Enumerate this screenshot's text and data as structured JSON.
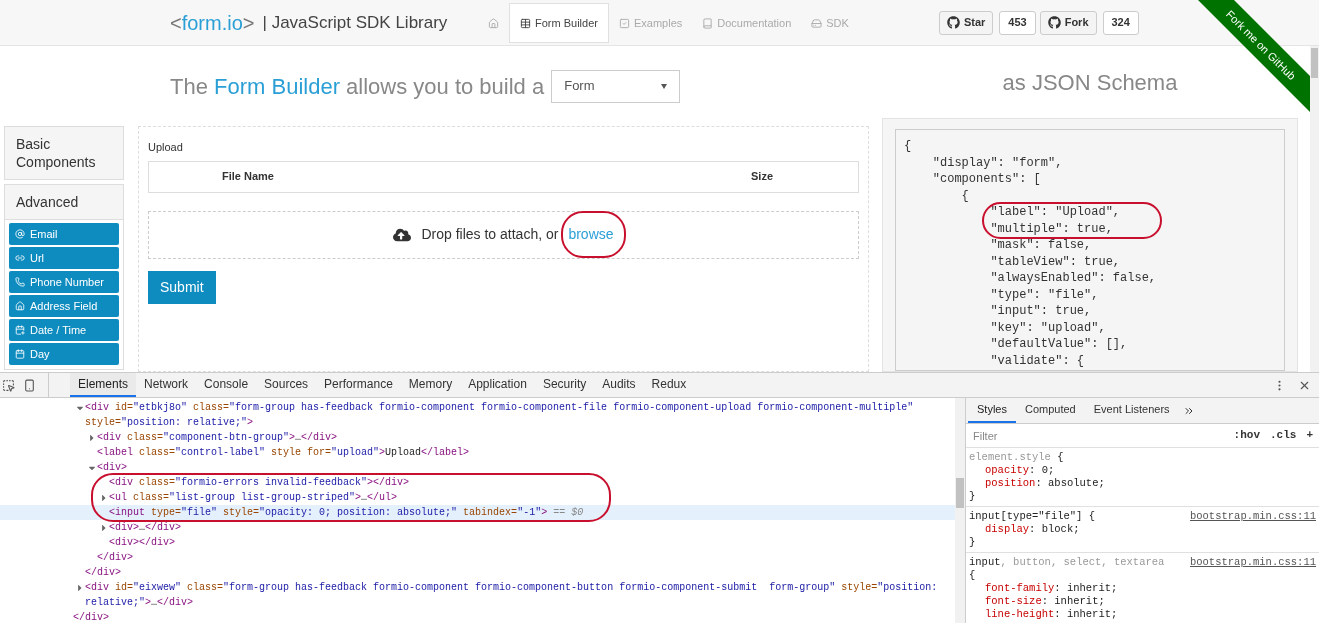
{
  "header": {
    "logo": {
      "open": "<",
      "name": "form.io",
      "close": ">"
    },
    "subtitle": "| JavaScript SDK Library",
    "nav": [
      {
        "selected": false
      },
      {
        "label": "Form Builder",
        "selected": true
      },
      {
        "label": "Examples",
        "selected": false
      },
      {
        "label": "Documentation",
        "selected": false
      },
      {
        "label": "SDK",
        "selected": false
      }
    ],
    "github": [
      {
        "label": "Star",
        "count": "453"
      },
      {
        "label": "Fork",
        "count": "324"
      }
    ],
    "ribbon": "Fork me on GitHub"
  },
  "builder": {
    "heading": [
      {
        "text": "The ",
        "accent": false
      },
      {
        "text": "Form Builder",
        "accent": true
      },
      {
        "text": " allows you to build a",
        "accent": false
      }
    ],
    "display_select": "Form",
    "groups": [
      "Basic Components",
      "Advanced"
    ],
    "components": [
      "Email",
      "Url",
      "Phone Number",
      "Address Field",
      "Date / Time",
      "Day"
    ],
    "form": {
      "upload_label": "Upload",
      "columns": [
        "File Name",
        "Size"
      ],
      "drop_text": "Drop files to attach, or",
      "browse_link": "browse",
      "browse_circled": true,
      "submit": "Submit"
    }
  },
  "schema": {
    "title": "as JSON Schema",
    "lines": [
      {
        "text": "{",
        "circled": false
      },
      {
        "text": "    \"display\": \"form\",",
        "circled": false
      },
      {
        "text": "    \"components\": [",
        "circled": false
      },
      {
        "text": "        {",
        "circled": false
      },
      {
        "text": "            \"label\": \"Upload\",",
        "circled": true
      },
      {
        "text": "            \"multiple\": true,",
        "circled": true
      },
      {
        "text": "            \"mask\": false,",
        "circled": false
      },
      {
        "text": "            \"tableView\": true,",
        "circled": false
      },
      {
        "text": "            \"alwaysEnabled\": false,",
        "circled": false
      },
      {
        "text": "            \"type\": \"file\",",
        "circled": false
      },
      {
        "text": "            \"input\": true,",
        "circled": false
      },
      {
        "text": "            \"key\": \"upload\",",
        "circled": false
      },
      {
        "text": "            \"defaultValue\": [],",
        "circled": false
      },
      {
        "text": "            \"validate\": {",
        "circled": false
      }
    ]
  },
  "devtools": {
    "tabs": [
      {
        "label": "Elements",
        "selected": true
      },
      {
        "label": "Network",
        "selected": false
      },
      {
        "label": "Console",
        "selected": false
      },
      {
        "label": "Sources",
        "selected": false
      },
      {
        "label": "Performance",
        "selected": false
      },
      {
        "label": "Memory",
        "selected": false
      },
      {
        "label": "Application",
        "selected": false
      },
      {
        "label": "Security",
        "selected": false
      },
      {
        "label": "Audits",
        "selected": false
      },
      {
        "label": "Redux",
        "selected": false
      }
    ],
    "dom": {
      "nodes": [
        {
          "expanded": true,
          "selected": false,
          "circled": false,
          "segs": [
            {
              "kind": "tag",
              "text": "<div"
            },
            {
              "kind": "attr",
              "text": " id="
            },
            {
              "kind": "val",
              "text": "\"etbkj8o\""
            },
            {
              "kind": "attr",
              "text": " class="
            },
            {
              "kind": "val",
              "text": "\"form-group has-feedback formio-component formio-component-file formio-component-upload formio-component-multiple\""
            },
            {
              "kind": "attr",
              "text": " style="
            },
            {
              "kind": "val",
              "text": "\"position: relative;\""
            },
            {
              "kind": "tag",
              "text": ">"
            }
          ],
          "children": [
            {
              "expanded": false,
              "selected": false,
              "circled": false,
              "segs": [
                {
                  "kind": "tag",
                  "text": "<div"
                },
                {
                  "kind": "attr",
                  "text": " class="
                },
                {
                  "kind": "val",
                  "text": "\"component-btn-group\""
                },
                {
                  "kind": "tag",
                  "text": ">"
                },
                {
                  "kind": "text",
                  "text": "…"
                },
                {
                  "kind": "tag",
                  "text": "</div>"
                }
              ]
            },
            {
              "selected": false,
              "circled": false,
              "segs": [
                {
                  "kind": "tag",
                  "text": "<label"
                },
                {
                  "kind": "attr",
                  "text": " class="
                },
                {
                  "kind": "val",
                  "text": "\"control-label\""
                },
                {
                  "kind": "attr",
                  "text": " style for="
                },
                {
                  "kind": "val",
                  "text": "\"upload\""
                },
                {
                  "kind": "tag",
                  "text": ">"
                },
                {
                  "kind": "text",
                  "text": "Upload"
                },
                {
                  "kind": "tag",
                  "text": "</label>"
                }
              ]
            },
            {
              "expanded": true,
              "selected": false,
              "circled": false,
              "segs": [
                {
                  "kind": "tag",
                  "text": "<div>"
                }
              ],
              "children": [
                {
                  "selected": false,
                  "circled": true,
                  "segs": [
                    {
                      "kind": "tag",
                      "text": "<div"
                    },
                    {
                      "kind": "attr",
                      "text": " class="
                    },
                    {
                      "kind": "val",
                      "text": "\"formio-errors invalid-feedback\""
                    },
                    {
                      "kind": "tag",
                      "text": ">"
                    },
                    {
                      "kind": "tag",
                      "text": "</div>"
                    }
                  ]
                },
                {
                  "expanded": false,
                  "selected": false,
                  "circled": true,
                  "segs": [
                    {
                      "kind": "tag",
                      "text": "<ul"
                    },
                    {
                      "kind": "attr",
                      "text": " class="
                    },
                    {
                      "kind": "val",
                      "text": "\"list-group list-group-striped\""
                    },
                    {
                      "kind": "tag",
                      "text": ">"
                    },
                    {
                      "kind": "text",
                      "text": "…"
                    },
                    {
                      "kind": "tag",
                      "text": "</ul>"
                    }
                  ]
                },
                {
                  "selected": true,
                  "circled": true,
                  "marker": "== $0",
                  "segs": [
                    {
                      "kind": "tag",
                      "text": "<input"
                    },
                    {
                      "kind": "attr",
                      "text": " type="
                    },
                    {
                      "kind": "val",
                      "text": "\"file\""
                    },
                    {
                      "kind": "attr",
                      "text": " style="
                    },
                    {
                      "kind": "val",
                      "text": "\"opacity: 0; position: absolute;\""
                    },
                    {
                      "kind": "attr",
                      "text": " tabindex="
                    },
                    {
                      "kind": "val",
                      "text": "\"-1\""
                    },
                    {
                      "kind": "tag",
                      "text": ">"
                    }
                  ]
                },
                {
                  "expanded": false,
                  "selected": false,
                  "circled": false,
                  "segs": [
                    {
                      "kind": "tag",
                      "text": "<div>"
                    },
                    {
                      "kind": "text",
                      "text": "…"
                    },
                    {
                      "kind": "tag",
                      "text": "</div>"
                    }
                  ]
                },
                {
                  "selected": false,
                  "circled": false,
                  "segs": [
                    {
                      "kind": "tag",
                      "text": "<div>"
                    },
                    {
                      "kind": "tag",
                      "text": "</div>"
                    }
                  ]
                }
              ],
              "close": [
                {
                  "kind": "tag",
                  "text": "</div>"
                }
              ]
            }
          ],
          "close": [
            {
              "kind": "tag",
              "text": "</div>"
            }
          ]
        },
        {
          "expanded": false,
          "selected": false,
          "circled": false,
          "segs": [
            {
              "kind": "tag",
              "text": "<div"
            },
            {
              "kind": "attr",
              "text": " id="
            },
            {
              "kind": "val",
              "text": "\"eixwew\""
            },
            {
              "kind": "attr",
              "text": " class="
            },
            {
              "kind": "val",
              "text": "\"form-group has-feedback formio-component formio-component-button formio-component-submit  form-group\""
            },
            {
              "kind": "attr",
              "text": " style="
            },
            {
              "kind": "val",
              "text": "\"position: relative;\""
            },
            {
              "kind": "tag",
              "text": ">"
            },
            {
              "kind": "text",
              "text": "…"
            },
            {
              "kind": "tag",
              "text": "</div>"
            }
          ]
        }
      ],
      "close": [
        {
          "kind": "tag",
          "text": "</div>"
        }
      ]
    },
    "styles_tabs": [
      {
        "label": "Styles",
        "selected": true
      },
      {
        "label": "Computed",
        "selected": false
      },
      {
        "label": "Event Listeners",
        "selected": false
      }
    ],
    "filter_placeholder": "Filter",
    "tools": [
      ":hov",
      ".cls",
      "+"
    ],
    "rules": [
      {
        "selector": [
          {
            "text": "element.style",
            "matched": false
          }
        ],
        "open": " {",
        "decls": [
          {
            "prop": "opacity",
            "rest": ": 0;"
          },
          {
            "prop": "position",
            "rest": ": absolute;"
          }
        ],
        "close": "}"
      },
      {
        "selector": [
          {
            "text": "input[type=\"file\"]",
            "matched": true
          }
        ],
        "open": " {",
        "source": "bootstrap.min.css:11",
        "decls": [
          {
            "prop": "display",
            "rest": ": block;"
          }
        ],
        "close": "}"
      },
      {
        "selector": [
          {
            "text": "input",
            "matched": true
          },
          {
            "text": ", button, select, textarea",
            "matched": false
          }
        ],
        "open": "{",
        "source": "bootstrap.min.css:11",
        "decls": [
          {
            "prop": "font-family",
            "rest": ": inherit;"
          },
          {
            "prop": "font-size",
            "rest": ": inherit;"
          },
          {
            "prop": "line-height",
            "rest": ": inherit;"
          }
        ]
      }
    ]
  }
}
